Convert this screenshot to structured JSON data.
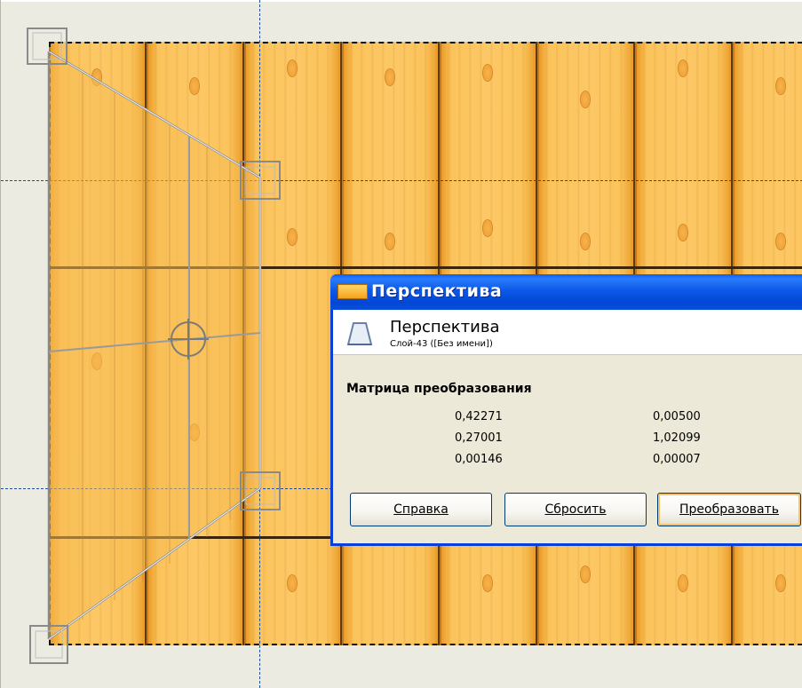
{
  "canvas": {
    "background_color": "#ecebe2",
    "guide_color": "#1e4e9a",
    "selection_outline": "dashed-black",
    "image": {
      "pattern": "wooden-planks",
      "plank_color": "#fcc866",
      "seam_color": "#3b2506"
    },
    "transform_handles": {
      "corner_handle_icon": "square-handle-icon",
      "center_handle_icon": "crosshair-circle-icon",
      "grid_color": "#8a8a8a"
    }
  },
  "dialog": {
    "title": "Перспектива",
    "title_icon": "layer-window-icon",
    "header": {
      "icon": "perspective-tool-icon",
      "heading": "Перспектива",
      "subheading": "Слой-43 ([Без имени])"
    },
    "matrix": {
      "label": "Матрица преобразования",
      "rows": [
        [
          "0,42271",
          "0,00500"
        ],
        [
          "0,27001",
          "1,02099"
        ],
        [
          "0,00146",
          "0,00007"
        ]
      ]
    },
    "buttons": {
      "help": "Справка",
      "reset": "Сбросить",
      "transform": "Преобразовать"
    }
  }
}
